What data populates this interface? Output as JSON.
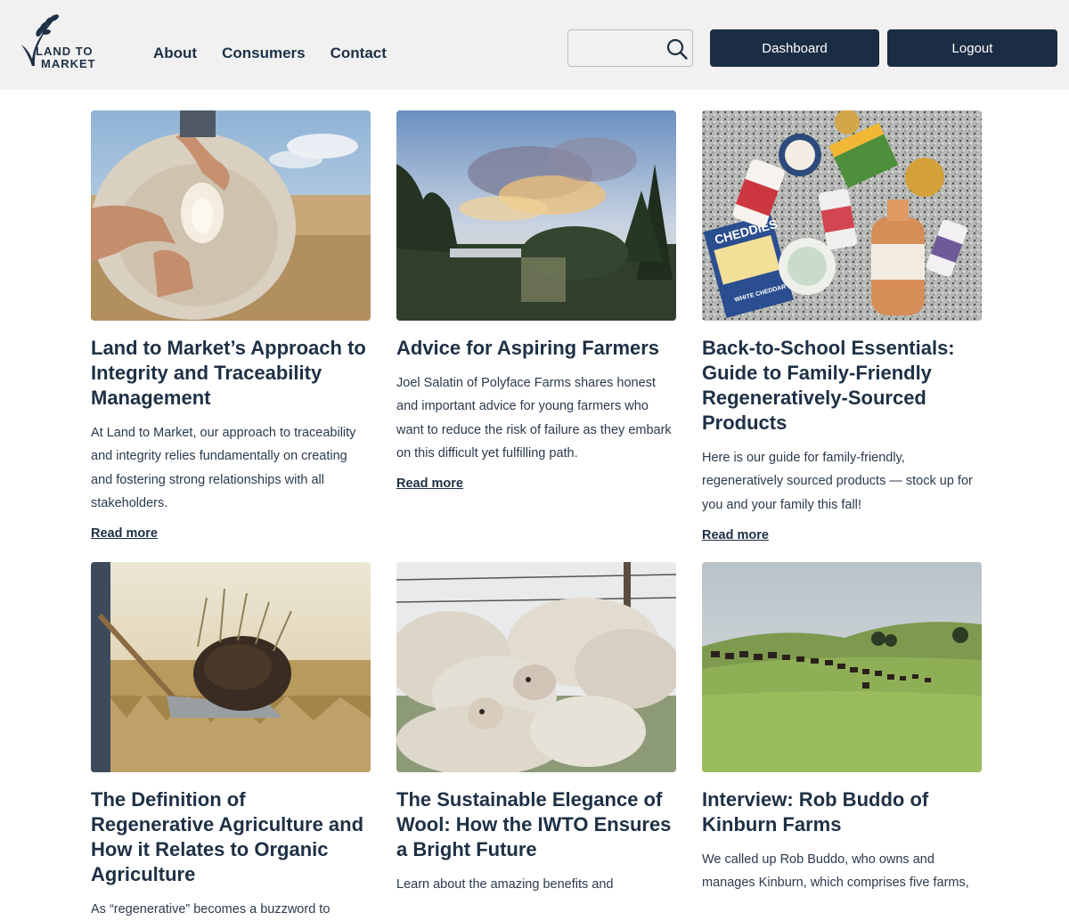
{
  "header": {
    "logo": {
      "line1": "LAND TO",
      "line2": "MARKET",
      "icon": "wheat-sprig-logo"
    },
    "nav": [
      {
        "label": "About"
      },
      {
        "label": "Consumers"
      },
      {
        "label": "Contact"
      }
    ],
    "search": {
      "value": "",
      "placeholder": "",
      "icon": "search-icon"
    },
    "dashboard_label": "Dashboard",
    "logout_label": "Logout"
  },
  "articles": [
    {
      "title": "Land to Market’s Approach to Integrity and Traceability Management",
      "excerpt": "At Land to Market, our approach to traceability and integrity relies fundamentally on creating and fostering strong relationships with all stakeholders.",
      "link": "Read more",
      "image": "sheep-fleece-photo"
    },
    {
      "title": "Advice for Aspiring Farmers",
      "excerpt": "Joel Salatin of Polyface Farms shares honest and important advice for young farmers who want to reduce the risk of failure as they embark on this difficult yet fulfilling path.",
      "link": "Read more",
      "image": "farm-sunset-photo"
    },
    {
      "title": "Back-to-School Essentials: Guide to Family-Friendly Regeneratively-Sourced Products",
      "excerpt": "Here is our guide for family-friendly, regeneratively sourced products — stock up for you and your family this fall!",
      "link": "Read more",
      "image": "products-flatlay-photo",
      "labels": {
        "cheddies": "CHEDDIES",
        "white_cheddar": "WHITE CHEDDAR"
      }
    },
    {
      "title": "The Definition of Regenerative Agriculture and How it Relates to Organic Agriculture",
      "excerpt": "As “regenerative” becomes a buzzword to",
      "image": "shovel-soil-photo"
    },
    {
      "title": "The Sustainable Elegance of Wool: How the IWTO Ensures a Bright Future",
      "excerpt": "Learn about the amazing benefits and",
      "image": "sheep-flock-photo"
    },
    {
      "title": "Interview: Rob Buddo of Kinburn Farms",
      "excerpt": "We called up Rob Buddo, who owns and manages Kinburn, which comprises five farms,",
      "image": "cattle-pasture-photo"
    }
  ]
}
